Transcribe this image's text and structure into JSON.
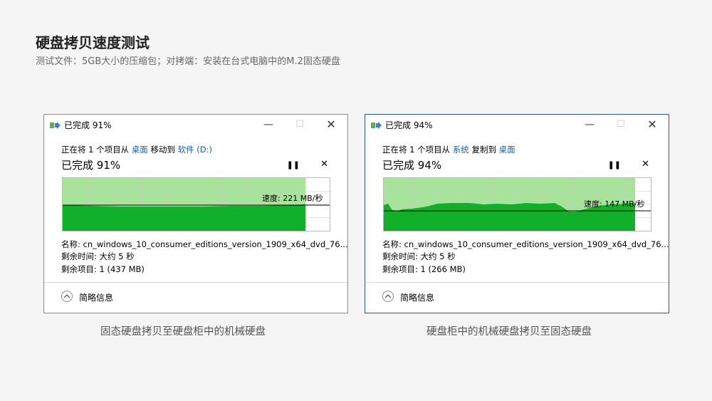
{
  "page": {
    "title": "硬盘拷贝速度测试",
    "subtitle": "测试文件：5GB大小的压缩包；对拷端：安装在台式电脑中的M.2固态硬盘"
  },
  "dialogs": [
    {
      "window_title": "已完成 91%",
      "status_prefix": "正在将 1 个项目从",
      "source": "桌面",
      "action": "移动到",
      "destination": "软件 (D:)",
      "heading": "已完成 91%",
      "speed_label": "速度: 221 MB/秒",
      "progress_percent": 91,
      "name_row": "名称: cn_windows_10_consumer_editions_version_1909_x64_dvd_76...",
      "time_row": "剩余时间: 大约 5 秒",
      "items_row": "剩余项目: 1 (437 MB)",
      "details_label": "简略信息",
      "caption": "固态硬盘拷贝至硬盘柜中的机械硬盘"
    },
    {
      "window_title": "已完成 94%",
      "status_prefix": "正在将 1 个项目从",
      "source": "系统",
      "action": "复制到",
      "destination": "桌面",
      "heading": "已完成 94%",
      "speed_label": "速度: 147 MB/秒",
      "progress_percent": 94,
      "name_row": "名称: cn_windows_10_consumer_editions_version_1909_x64_dvd_76...",
      "time_row": "剩余时间: 大约 5 秒",
      "items_row": "剩余项目: 1 (266 MB)",
      "details_label": "简略信息",
      "caption": "硬盘柜中的机械硬盘拷贝至固态硬盘"
    }
  ],
  "icons": {
    "minimize": "minimize-icon",
    "maximize": "maximize-icon",
    "close": "close-icon",
    "pause": "pause-icon",
    "cancel": "cancel-icon",
    "chevron": "chevron-up-icon"
  },
  "colors": {
    "graph_fill": "#10b02a",
    "graph_background": "#a7e39a",
    "link": "#1a5fb4"
  }
}
